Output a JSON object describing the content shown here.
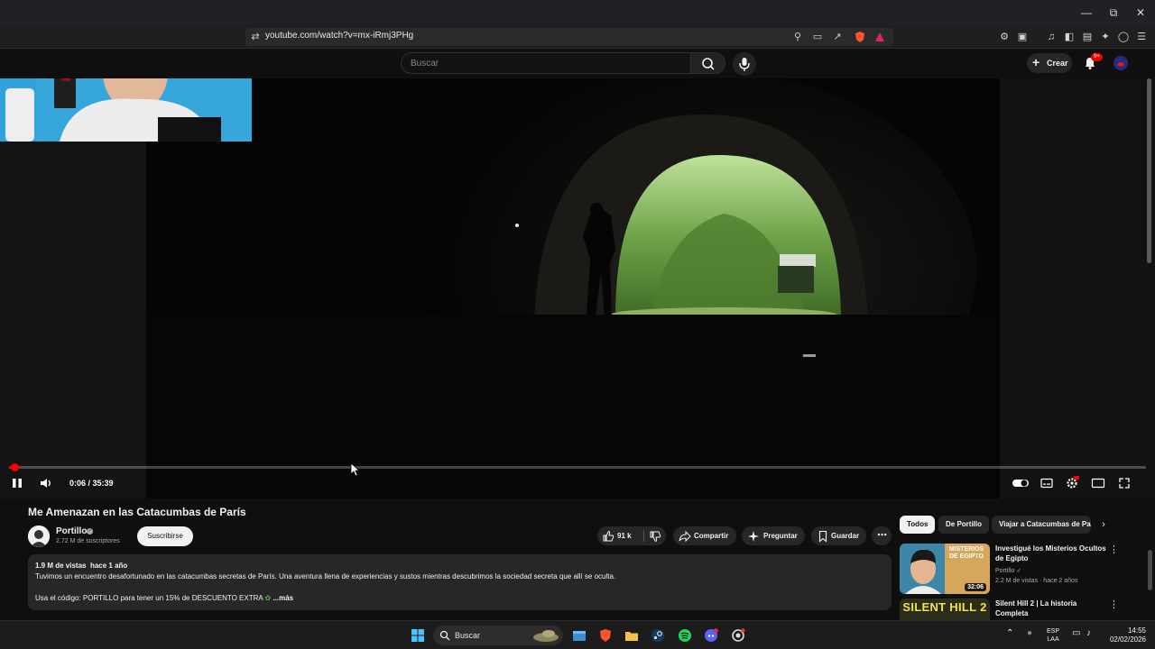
{
  "browser": {
    "url": "youtube.com/watch?v=mx-iRmj3PHg"
  },
  "youtube": {
    "search_placeholder": "Buscar",
    "create_label": "Crear",
    "notifications_badge": "9+"
  },
  "player": {
    "time": "0:06 / 35:39",
    "progress": 0.0028,
    "state": "playing"
  },
  "video": {
    "title": "Me Amenazan en las Catacumbas de París",
    "channel": "Portillo",
    "subscribers": "2.72 M de suscriptores",
    "subscribe_label": "Suscribirse",
    "likes": "91 k",
    "share_label": "Compartir",
    "ask_label": "Preguntar",
    "save_label": "Guardar",
    "views": "1.9 M de vistas",
    "age": "hace 1 año",
    "description_line1": "Tuvimos un encuentro desafortunado en las catacumbas secretas de París. Una aventura llena de experiencias y sustos mientras descubrimos la sociedad secreta que allí se oculta.",
    "description_line2": "Usa el código: PORTILLO para tener un 15% de DESCUENTO EXTRA",
    "more_label": "...más"
  },
  "chips": [
    "Todos",
    "De Portillo",
    "Viajar a Catacumbas de Pa"
  ],
  "recommendations": [
    {
      "title": "Investigué los Misterios Ocultos de Egipto",
      "channel": "Portillo",
      "meta": "2.2 M de vistas · hace 2 años",
      "duration": "32:06",
      "thumb_text": "MISTERIOS DE EGIPTO"
    },
    {
      "title": "Silent Hill 2 | La historia Completa",
      "thumb_text": "SILENT HILL 2"
    }
  ],
  "taskbar": {
    "search_label": "Buscar",
    "lang_line1": "ESP",
    "lang_line2": "LAA",
    "time": "14:55",
    "date": "02/02/2026"
  },
  "colors": {
    "accent_red": "#ff0000",
    "background": "#0f0f0f",
    "surface": "#272727"
  }
}
